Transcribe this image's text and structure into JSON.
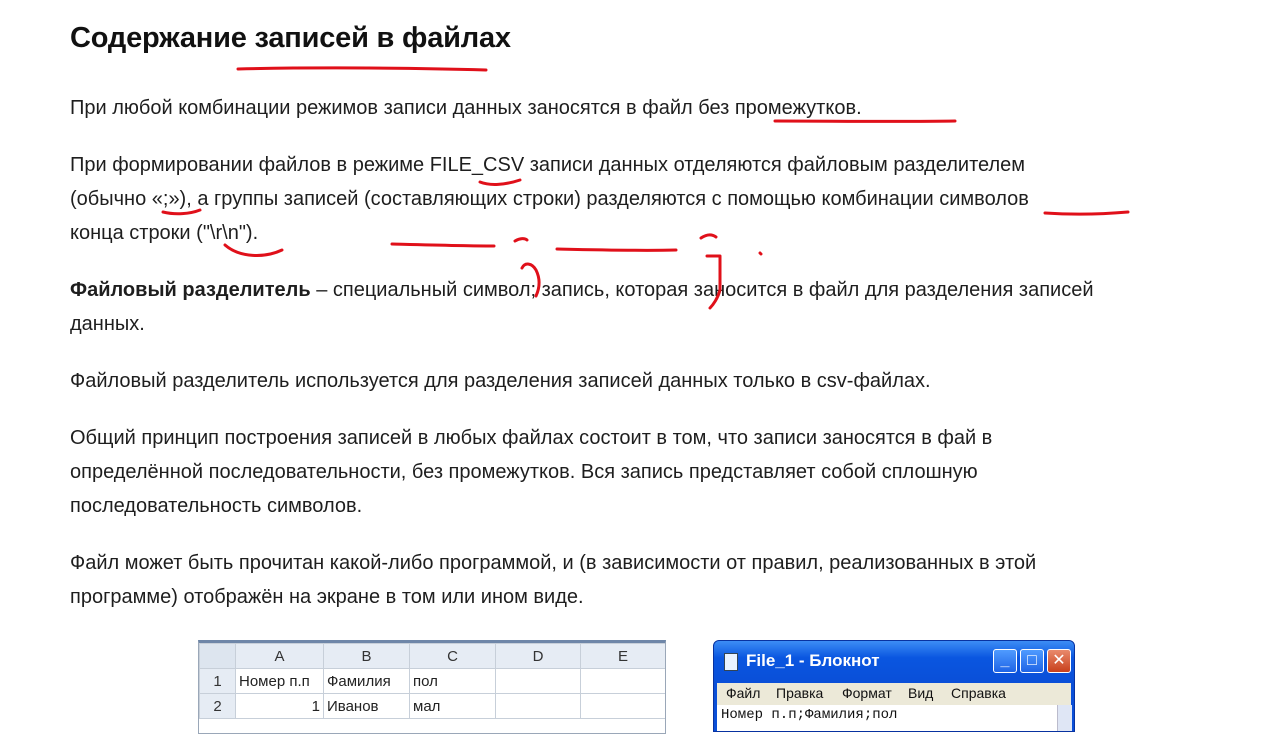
{
  "title": "Содержание записей в файлах",
  "paragraphs": {
    "p1": "При любой комбинации режимов записи данных заносятся в файл без промежутков.",
    "p2a": "При формировании файлов в режиме FILE_CSV записи данных отделяются файловым разделителем",
    "p2b": "(обычно «;»), а группы записей (составляющих строки) разделяются с помощью комбинации символов",
    "p2c": "конца строки (\"\\r\\n\").",
    "p3_bold": "Файловый разделитель",
    "p3_rest": " – специальный символ; запись, которая заносится в файл для разделения записей",
    "p3b": "данных.",
    "p4": "Файловый разделитель используется для разделения записей данных только в csv-файлах.",
    "p5a": "Общий принцип построения записей в любых файлах состоит в том, что записи заносятся в фай в",
    "p5b": "определённой последовательности, без промежутков. Вся запись представляет собой сплошную",
    "p5c": "последовательность символов.",
    "p6a": "Файл может быть прочитан какой-либо программой, и (в зависимости от правил, реализованных в этой",
    "p6b": "программе) отображён на экране в том или ином виде."
  },
  "spreadsheet": {
    "columns": [
      "A",
      "B",
      "C",
      "D",
      "E"
    ],
    "rows": [
      {
        "n": "1",
        "cells": [
          "Номер п.п",
          "Фамилия",
          "пол",
          "",
          ""
        ]
      },
      {
        "n": "2",
        "cells": [
          "1",
          "Иванов",
          "мал",
          "",
          ""
        ]
      }
    ]
  },
  "notepad": {
    "title": "File_1 - Блокнот",
    "buttons": {
      "minimize": "_",
      "maximize": "□",
      "close": "✕"
    },
    "menu": [
      "Файл",
      "Правка",
      "Формат",
      "Вид",
      "Справка"
    ],
    "text": "Номер п.п;Фамилия;пол"
  },
  "colors": {
    "ink": "#e0101a",
    "text": "#1e1e1e",
    "xp_blue": "#0a4fd8"
  }
}
